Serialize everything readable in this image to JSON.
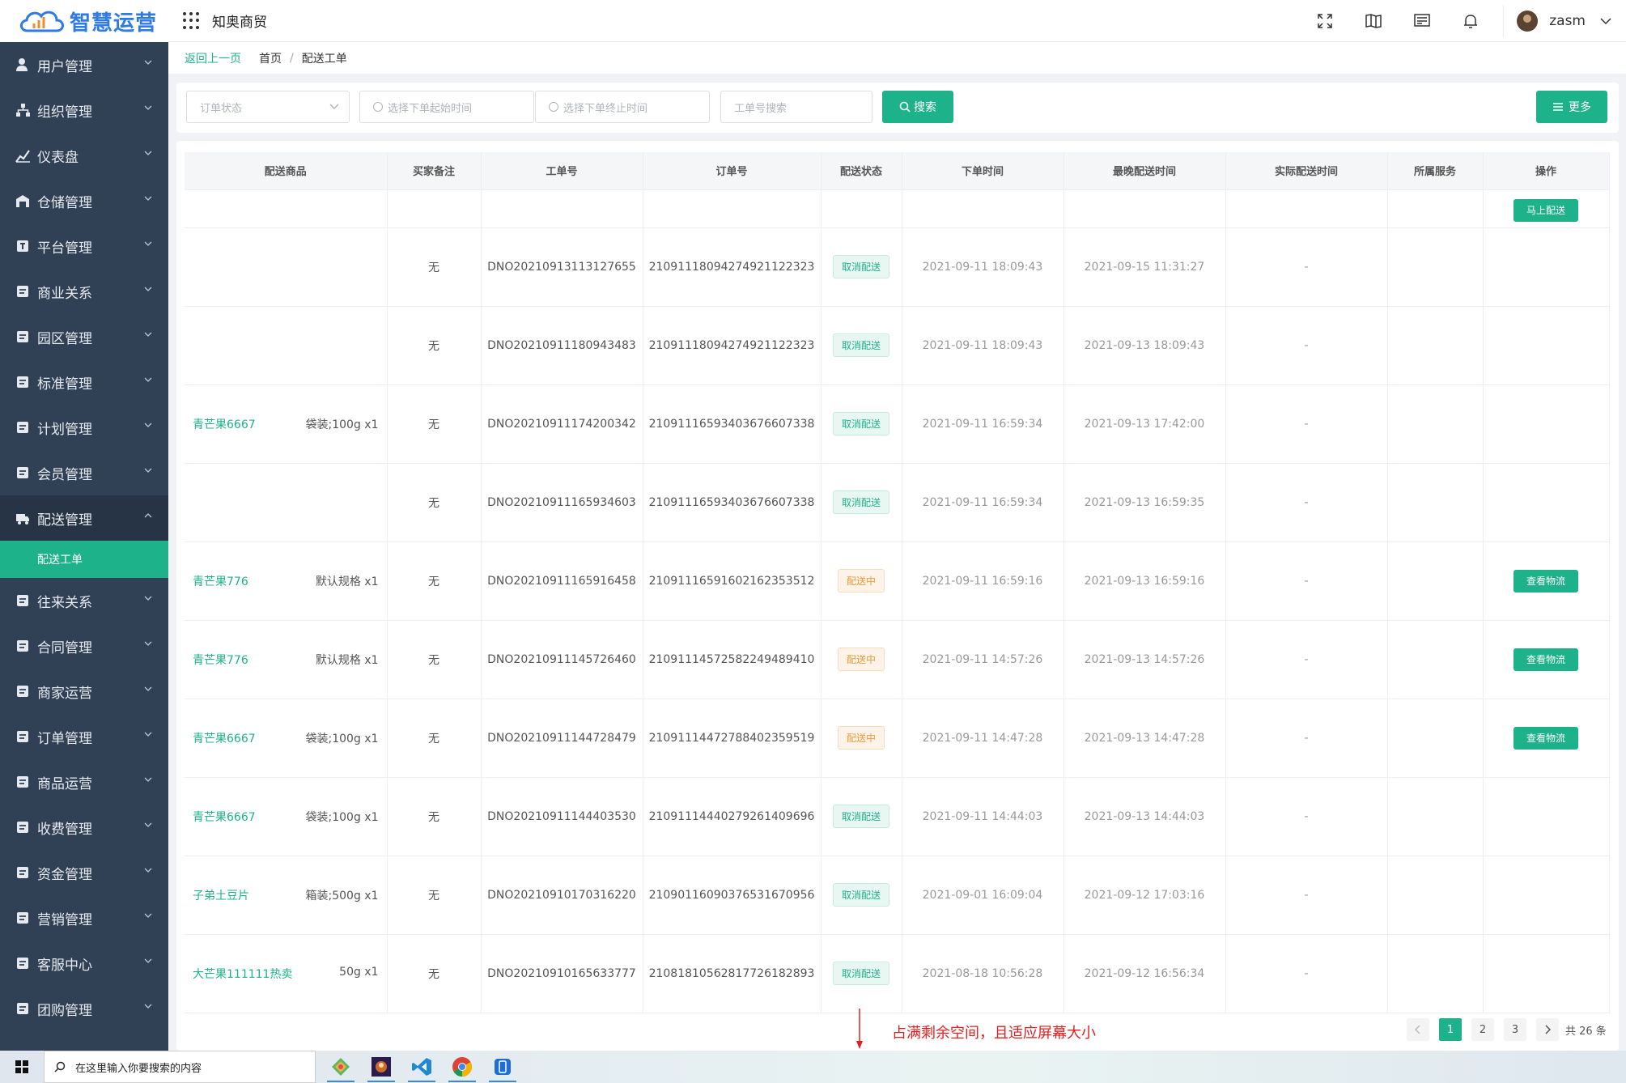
{
  "brand": {
    "name": "智慧运营",
    "color": "#2e7be4"
  },
  "accent": "#1eb28a",
  "sidebar": {
    "items": [
      {
        "label": "用户管理",
        "icon": "user-icon"
      },
      {
        "label": "组织管理",
        "icon": "org-icon"
      },
      {
        "label": "仪表盘",
        "icon": "dashboard-icon"
      },
      {
        "label": "仓储管理",
        "icon": "warehouse-icon"
      },
      {
        "label": "平台管理",
        "icon": "platform-icon"
      },
      {
        "label": "商业关系",
        "icon": "business-icon"
      },
      {
        "label": "园区管理",
        "icon": "park-icon"
      },
      {
        "label": "标准管理",
        "icon": "standard-icon"
      },
      {
        "label": "计划管理",
        "icon": "plan-icon"
      },
      {
        "label": "会员管理",
        "icon": "member-icon"
      },
      {
        "label": "配送管理",
        "icon": "truck-icon",
        "open": true
      },
      {
        "label": "往来关系",
        "icon": "relation-icon"
      },
      {
        "label": "合同管理",
        "icon": "contract-icon"
      },
      {
        "label": "商家运营",
        "icon": "shop-icon"
      },
      {
        "label": "订单管理",
        "icon": "order-icon"
      },
      {
        "label": "商品运营",
        "icon": "goods-icon"
      },
      {
        "label": "收费管理",
        "icon": "fee-icon"
      },
      {
        "label": "资金管理",
        "icon": "fund-icon"
      },
      {
        "label": "营销管理",
        "icon": "marketing-icon"
      },
      {
        "label": "客服中心",
        "icon": "service-icon"
      },
      {
        "label": "团购管理",
        "icon": "groupbuy-icon"
      }
    ],
    "submenu": {
      "label": "配送工单"
    }
  },
  "header": {
    "company": "知奥商贸",
    "username": "zasm"
  },
  "breadcrumb": {
    "back": "返回上一页",
    "home": "首页",
    "current": "配送工单"
  },
  "filter": {
    "status_placeholder": "订单状态",
    "start_placeholder": "选择下单起始时间",
    "end_placeholder": "选择下单终止时间",
    "no_placeholder": "工单号搜索",
    "search_label": "搜索",
    "more_label": "更多"
  },
  "table": {
    "columns": [
      "配送商品",
      "买家备注",
      "工单号",
      "订单号",
      "配送状态",
      "下单时间",
      "最晚配送时间",
      "实际配送时间",
      "所属服务",
      "操作"
    ],
    "partial_row_action": "马上配送",
    "rows": [
      {
        "goods": "",
        "spec": "",
        "note": "无",
        "work_no": "DNO20210913113127655",
        "order_no": "21091118094274921122323",
        "status": "取消配送",
        "status_type": "cancel",
        "order_time": "2021-09-11 18:09:43",
        "latest_time": "2021-09-15 11:31:27",
        "actual_time": "-",
        "action": ""
      },
      {
        "goods": "",
        "spec": "",
        "note": "无",
        "work_no": "DNO20210911180943483",
        "order_no": "21091118094274921122323",
        "status": "取消配送",
        "status_type": "cancel",
        "order_time": "2021-09-11 18:09:43",
        "latest_time": "2021-09-13 18:09:43",
        "actual_time": "-",
        "action": ""
      },
      {
        "goods": "青芒果6667",
        "spec": "袋装;100g x1",
        "note": "无",
        "work_no": "DNO20210911174200342",
        "order_no": "21091116593403676607338",
        "status": "取消配送",
        "status_type": "cancel",
        "order_time": "2021-09-11 16:59:34",
        "latest_time": "2021-09-13 17:42:00",
        "actual_time": "-",
        "action": ""
      },
      {
        "goods": "",
        "spec": "",
        "note": "无",
        "work_no": "DNO20210911165934603",
        "order_no": "21091116593403676607338",
        "status": "取消配送",
        "status_type": "cancel",
        "order_time": "2021-09-11 16:59:34",
        "latest_time": "2021-09-13 16:59:35",
        "actual_time": "-",
        "action": ""
      },
      {
        "goods": "青芒果776",
        "spec": "默认规格 x1",
        "note": "无",
        "work_no": "DNO20210911165916458",
        "order_no": "21091116591602162353512",
        "status": "配送中",
        "status_type": "ship",
        "order_time": "2021-09-11 16:59:16",
        "latest_time": "2021-09-13 16:59:16",
        "actual_time": "-",
        "action": "查看物流"
      },
      {
        "goods": "青芒果776",
        "spec": "默认规格 x1",
        "note": "无",
        "work_no": "DNO20210911145726460",
        "order_no": "21091114572582249489410",
        "status": "配送中",
        "status_type": "ship",
        "order_time": "2021-09-11 14:57:26",
        "latest_time": "2021-09-13 14:57:26",
        "actual_time": "-",
        "action": "查看物流"
      },
      {
        "goods": "青芒果6667",
        "spec": "袋装;100g x1",
        "note": "无",
        "work_no": "DNO20210911144728479",
        "order_no": "21091114472788402359519",
        "status": "配送中",
        "status_type": "ship",
        "order_time": "2021-09-11 14:47:28",
        "latest_time": "2021-09-13 14:47:28",
        "actual_time": "-",
        "action": "查看物流"
      },
      {
        "goods": "青芒果6667",
        "spec": "袋装;100g x1",
        "note": "无",
        "work_no": "DNO20210911144403530",
        "order_no": "21091114440279261409696",
        "status": "取消配送",
        "status_type": "cancel",
        "order_time": "2021-09-11 14:44:03",
        "latest_time": "2021-09-13 14:44:03",
        "actual_time": "-",
        "action": ""
      },
      {
        "goods": "子弟土豆片",
        "spec": "箱装;500g x1",
        "note": "无",
        "work_no": "DNO20210910170316220",
        "order_no": "21090116090376531670956",
        "status": "取消配送",
        "status_type": "cancel",
        "order_time": "2021-09-01 16:09:04",
        "latest_time": "2021-09-12 17:03:16",
        "actual_time": "-",
        "action": ""
      },
      {
        "goods": "大芒果111111热卖",
        "spec": "50g x1",
        "note": "无",
        "work_no": "DNO20210910165633777",
        "order_no": "21081810562817726182893",
        "status": "取消配送",
        "status_type": "cancel",
        "order_time": "2021-08-18 10:56:28",
        "latest_time": "2021-09-12 16:56:34",
        "actual_time": "-",
        "action": ""
      }
    ]
  },
  "pagination": {
    "pages": [
      "1",
      "2",
      "3"
    ],
    "current": "1",
    "total": "共 26 条"
  },
  "annotation": {
    "text": "占满剩余空间，且适应屏幕大小"
  },
  "taskbar": {
    "search_placeholder": "在这里输入你要搜索的内容"
  }
}
